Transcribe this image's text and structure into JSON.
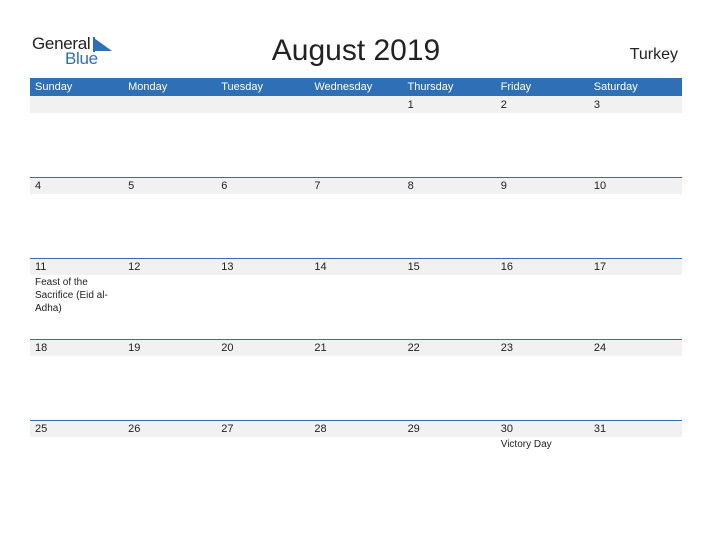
{
  "logo": {
    "general": "General",
    "blue": "Blue"
  },
  "title": "August 2019",
  "country": "Turkey",
  "colors": {
    "accent": "#2e6fb5",
    "strip": "#f1f1f1"
  },
  "weekdays": [
    "Sunday",
    "Monday",
    "Tuesday",
    "Wednesday",
    "Thursday",
    "Friday",
    "Saturday"
  ],
  "weeks": [
    [
      {
        "day": ""
      },
      {
        "day": ""
      },
      {
        "day": ""
      },
      {
        "day": ""
      },
      {
        "day": "1"
      },
      {
        "day": "2"
      },
      {
        "day": "3"
      }
    ],
    [
      {
        "day": "4"
      },
      {
        "day": "5"
      },
      {
        "day": "6"
      },
      {
        "day": "7"
      },
      {
        "day": "8"
      },
      {
        "day": "9"
      },
      {
        "day": "10"
      }
    ],
    [
      {
        "day": "11",
        "event": "Feast of the Sacrifice (Eid al-Adha)"
      },
      {
        "day": "12"
      },
      {
        "day": "13"
      },
      {
        "day": "14"
      },
      {
        "day": "15"
      },
      {
        "day": "16"
      },
      {
        "day": "17"
      }
    ],
    [
      {
        "day": "18"
      },
      {
        "day": "19"
      },
      {
        "day": "20"
      },
      {
        "day": "21"
      },
      {
        "day": "22"
      },
      {
        "day": "23"
      },
      {
        "day": "24"
      }
    ],
    [
      {
        "day": "25"
      },
      {
        "day": "26"
      },
      {
        "day": "27"
      },
      {
        "day": "28"
      },
      {
        "day": "29"
      },
      {
        "day": "30",
        "event": "Victory Day"
      },
      {
        "day": "31"
      }
    ]
  ]
}
